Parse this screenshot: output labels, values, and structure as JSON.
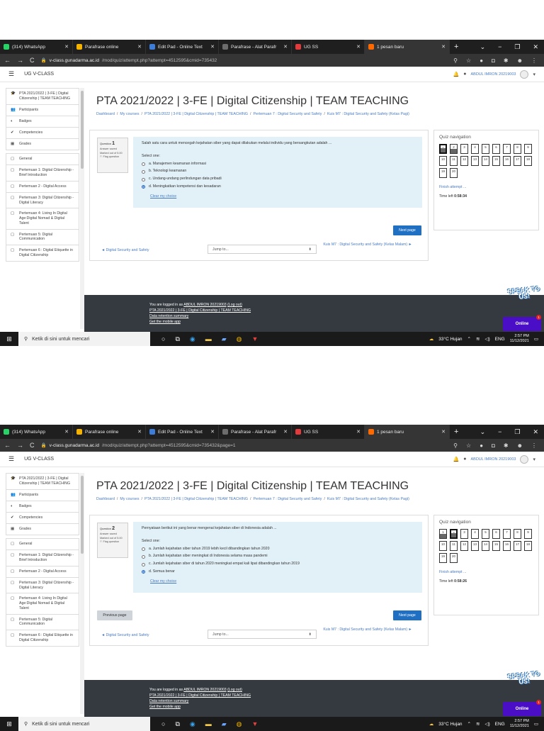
{
  "screenshots": [
    {
      "tabs": [
        {
          "title": "(314) WhatsApp",
          "icon": "whatsapp-icon",
          "color": "#25d366"
        },
        {
          "title": "Parafrase online",
          "icon": "parafrase-icon",
          "color": "#f5b300"
        },
        {
          "title": "Edit Pad - Online Text",
          "icon": "editpad-icon",
          "color": "#3b7dd8"
        },
        {
          "title": "Parafrase - Alat Parafr",
          "icon": "parafrase-tool-icon",
          "color": "#6c6c6c"
        },
        {
          "title": "UG SS",
          "icon": "ug-ss-icon",
          "color": "#e33b3b"
        },
        {
          "title": "1 pesan baru",
          "icon": "message-icon",
          "color": "#ff6a00",
          "active": true
        }
      ],
      "url_host": "v-class.gunadarma.ac.id",
      "url_path": "/mod/quiz/attempt.php?attempt=4512595&cmid=735432",
      "site_name": "UG V-CLASS",
      "user_name": "ABDUL IMRON 20219003",
      "drawer": [
        {
          "icon": "graduation-cap-icon",
          "label": "PTA 2021/2022 | 3-FE | Digital Citizenship | TEAM TEACHING"
        },
        {
          "icon": "users-icon",
          "label": "Participants"
        },
        {
          "icon": "badge-icon",
          "label": "Badges"
        },
        {
          "icon": "check-icon",
          "label": "Competencies"
        },
        {
          "icon": "table-icon",
          "label": "Grades"
        },
        {
          "icon": "folder-icon",
          "label": "General",
          "gap": true
        },
        {
          "icon": "folder-icon",
          "label": "Pertemuan 1: Digital Citizenship - Brief Introduction"
        },
        {
          "icon": "folder-icon",
          "label": "Pertemuan 2 - Digital Access"
        },
        {
          "icon": "folder-icon",
          "label": "Pertemuan 3: Digital Citizenship - Digital Literacy"
        },
        {
          "icon": "folder-icon",
          "label": "Pertemuan 4: Living In Digital Age:Digital Nomad & Digital Talent"
        },
        {
          "icon": "folder-icon",
          "label": "Pertemuan 5: Digital Communication"
        },
        {
          "icon": "folder-icon",
          "label": "Pertemuan 6 : Digital Etiquette in Digital Citizenship"
        }
      ],
      "page_title": "PTA 2021/2022 | 3-FE | Digital Citizenship | TEAM TEACHING",
      "breadcrumb": [
        "Dashboard",
        "My courses",
        "PTA 2021/2022 | 3-FE | Digital Citizenship | TEAM TEACHING",
        "Pertemuan 7 : Digital Security and Safety",
        "Kuis M7 : Digital Security and Safety (Kelas Pagi)"
      ],
      "question": {
        "label": "Question",
        "number": "1",
        "status": "Answer saved",
        "marks": "Marked out of 5.00",
        "flag": "Flag question",
        "text": "Salah satu cara untuk mencegah kejahatan siber yang dapat dilakukan melalui individu yang bersangkutan adalah ...",
        "select_one": "Select one:",
        "options": [
          {
            "text": "a. Manajemen keamanan informasi",
            "checked": false
          },
          {
            "text": "b. Teknologi keamanan",
            "checked": false
          },
          {
            "text": "c. Undang-undang perlindungan data pribadi",
            "checked": false
          },
          {
            "text": "d. Meningkatkan kompetensi dan kesadaran",
            "checked": true
          }
        ],
        "clear": "Clear my choice"
      },
      "show_prev": false,
      "prev_label": "",
      "next_label": "Next page",
      "activity_prev": "◄ Digital Security and Safety",
      "jump_to": "Jump to...",
      "activity_next": "Kuis M7 : Digital Security and Safety (Kelas Malam) ►",
      "qnav": {
        "title": "Quiz navigation",
        "buttons": [
          "1",
          "2",
          "3",
          "4",
          "5",
          "6",
          "7",
          "8",
          "9",
          "10",
          "11",
          "12",
          "13",
          "14",
          "15",
          "16",
          "17",
          "18",
          "19",
          "20"
        ],
        "answered": [
          1,
          2
        ],
        "current": 1,
        "finish": "Finish attempt ...",
        "time_label": "Time left",
        "time_value": "0:58:34"
      },
      "footer": {
        "logged_prefix": "You are logged in as",
        "logged_user": "ABDUL IMRON 20219003",
        "logout": "(Log out)",
        "course": "PTA 2021/2022 | 3-FE | Digital Citizenship | TEAM TEACHING",
        "retention": "Data retention summary",
        "mobile": "Get the mobile app"
      },
      "speak": "SPEAK TO US!",
      "online": "Online",
      "online_badge": "1",
      "taskbar": {
        "search": "Ketik di sini untuk mencari",
        "weather": "33°C Hujan",
        "lang": "ENG",
        "time": "2:57 PM",
        "date": "11/12/2021"
      }
    },
    {
      "tabs": [
        {
          "title": "(314) WhatsApp",
          "icon": "whatsapp-icon",
          "color": "#25d366"
        },
        {
          "title": "Parafrase online",
          "icon": "parafrase-icon",
          "color": "#f5b300"
        },
        {
          "title": "Edit Pad - Online Text",
          "icon": "editpad-icon",
          "color": "#3b7dd8"
        },
        {
          "title": "Parafrase - Alat Parafr",
          "icon": "parafrase-tool-icon",
          "color": "#6c6c6c"
        },
        {
          "title": "UG SS",
          "icon": "ug-ss-icon",
          "color": "#e33b3b"
        },
        {
          "title": "1 pesan baru",
          "icon": "message-icon",
          "color": "#ff6a00",
          "active": true
        }
      ],
      "url_host": "v-class.gunadarma.ac.id",
      "url_path": "/mod/quiz/attempt.php?attempt=4512595&cmid=735432&page=1",
      "site_name": "UG V-CLASS",
      "user_name": "ABDUL IMRON 20219003",
      "drawer": [
        {
          "icon": "graduation-cap-icon",
          "label": "PTA 2021/2022 | 3-FE | Digital Citizenship | TEAM TEACHING"
        },
        {
          "icon": "users-icon",
          "label": "Participants"
        },
        {
          "icon": "badge-icon",
          "label": "Badges"
        },
        {
          "icon": "check-icon",
          "label": "Competencies"
        },
        {
          "icon": "table-icon",
          "label": "Grades"
        },
        {
          "icon": "folder-icon",
          "label": "General",
          "gap": true
        },
        {
          "icon": "folder-icon",
          "label": "Pertemuan 1: Digital Citizenship - Brief Introduction"
        },
        {
          "icon": "folder-icon",
          "label": "Pertemuan 2 - Digital Access"
        },
        {
          "icon": "folder-icon",
          "label": "Pertemuan 3: Digital Citizenship - Digital Literacy"
        },
        {
          "icon": "folder-icon",
          "label": "Pertemuan 4: Living In Digital Age:Digital Nomad & Digital Talent"
        },
        {
          "icon": "folder-icon",
          "label": "Pertemuan 5: Digital Communication"
        },
        {
          "icon": "folder-icon",
          "label": "Pertemuan 6 : Digital Etiquette in Digital Citizenship"
        }
      ],
      "page_title": "PTA 2021/2022 | 3-FE | Digital Citizenship | TEAM TEACHING",
      "breadcrumb": [
        "Dashboard",
        "My courses",
        "PTA 2021/2022 | 3-FE | Digital Citizenship | TEAM TEACHING",
        "Pertemuan 7 : Digital Security and Safety",
        "Kuis M7 : Digital Security and Safety (Kelas Pagi)"
      ],
      "question": {
        "label": "Question",
        "number": "2",
        "status": "Answer saved",
        "marks": "Marked out of 5.00",
        "flag": "Flag question",
        "text": "Pernyataan berikut ini yang benar mengenai kejahatan siber di Indonesia adalah ...",
        "select_one": "Select one:",
        "options": [
          {
            "text": "a. Jumlah kejahatan siber tahun 2019 lebih kecil dibandingkan tahun 2020",
            "checked": false
          },
          {
            "text": "b. Jumlah kejahatan siber meningkat di Indonesia selama masa pandemi",
            "checked": false
          },
          {
            "text": "c. Jumlah kejahatan siber di tahun 2020 meningkat empat kali lipat dibandingkan tahun 2019",
            "checked": false
          },
          {
            "text": "d. Semua benar",
            "checked": true
          }
        ],
        "clear": "Clear my choice"
      },
      "show_prev": true,
      "prev_label": "Previous page",
      "next_label": "Next page",
      "activity_prev": "◄ Digital Security and Safety",
      "jump_to": "Jump to...",
      "activity_next": "Kuis M7 : Digital Security and Safety (Kelas Malam) ►",
      "qnav": {
        "title": "Quiz navigation",
        "buttons": [
          "1",
          "2",
          "3",
          "4",
          "5",
          "6",
          "7",
          "8",
          "9",
          "10",
          "11",
          "12",
          "13",
          "14",
          "15",
          "16",
          "17",
          "18",
          "19",
          "20"
        ],
        "answered": [
          1,
          2
        ],
        "current": 2,
        "finish": "Finish attempt ...",
        "time_label": "Time left",
        "time_value": "0:58:26"
      },
      "footer": {
        "logged_prefix": "You are logged in as",
        "logged_user": "ABDUL IMRON 20219003",
        "logout": "(Log out)",
        "course": "PTA 2021/2022 | 3-FE | Digital Citizenship | TEAM TEACHING",
        "retention": "Data retention summary",
        "mobile": "Get the mobile app"
      },
      "speak": "SPEAK TO US!",
      "online": "Online",
      "online_badge": "1",
      "taskbar": {
        "search": "Ketik di sini untuk mencari",
        "weather": "33°C Hujan",
        "lang": "ENG",
        "time": "2:57 PM",
        "date": "11/12/2021"
      }
    }
  ]
}
